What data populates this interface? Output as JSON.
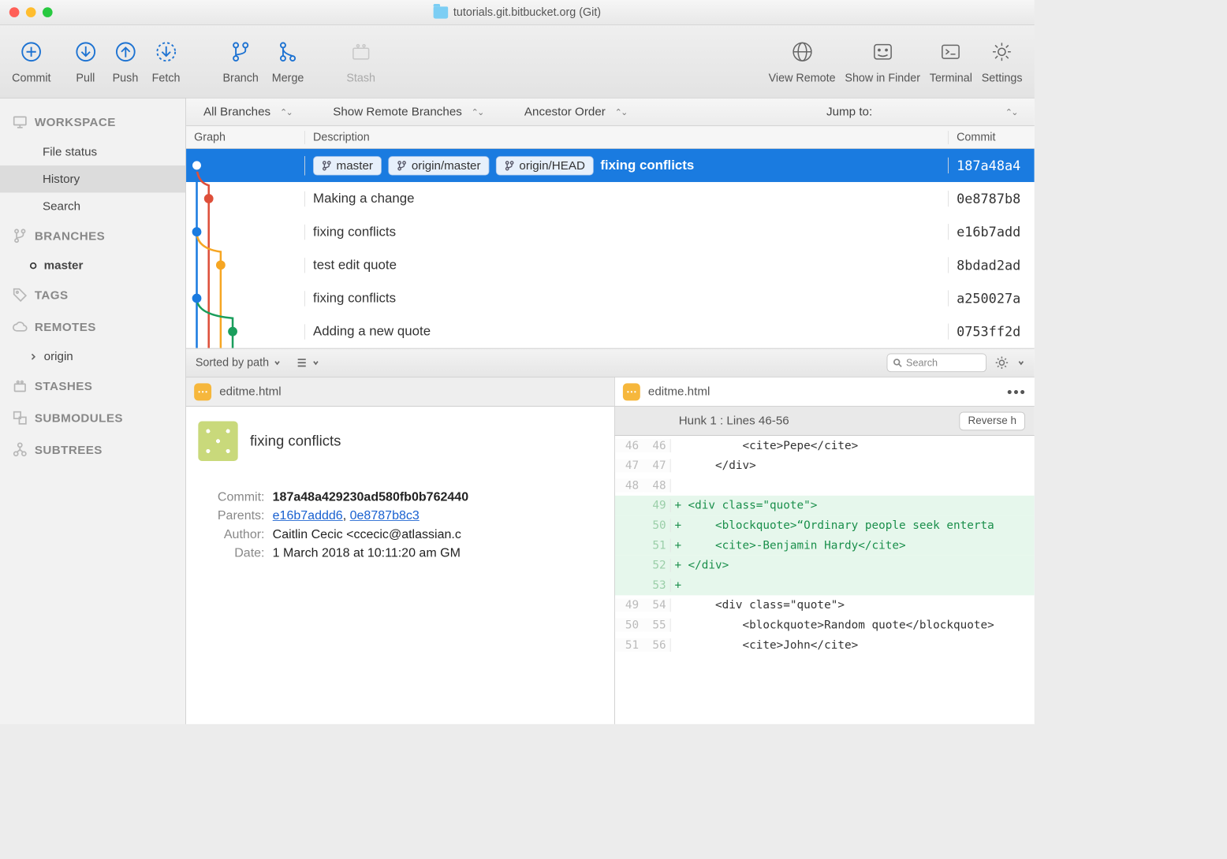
{
  "window": {
    "title": "tutorials.git.bitbucket.org (Git)"
  },
  "toolbar": {
    "commit": "Commit",
    "pull": "Pull",
    "push": "Push",
    "fetch": "Fetch",
    "branch": "Branch",
    "merge": "Merge",
    "stash": "Stash",
    "view_remote": "View Remote",
    "show_finder": "Show in Finder",
    "terminal": "Terminal",
    "settings": "Settings"
  },
  "sidebar": {
    "workspace": {
      "header": "WORKSPACE",
      "file_status": "File status",
      "history": "History",
      "search": "Search"
    },
    "branches": {
      "header": "BRANCHES",
      "master": "master"
    },
    "tags": {
      "header": "TAGS"
    },
    "remotes": {
      "header": "REMOTES",
      "origin": "origin"
    },
    "stashes": {
      "header": "STASHES"
    },
    "submodules": {
      "header": "SUBMODULES"
    },
    "subtrees": {
      "header": "SUBTREES"
    }
  },
  "filter": {
    "branches": "All Branches",
    "remote": "Show Remote Branches",
    "order": "Ancestor Order",
    "jump": "Jump to:"
  },
  "columns": {
    "graph": "Graph",
    "desc": "Description",
    "commit": "Commit"
  },
  "commits": [
    {
      "desc": "fixing conflicts",
      "hash": "187a48a4",
      "tags": [
        "master",
        "origin/master",
        "origin/HEAD"
      ],
      "selected": true
    },
    {
      "desc": "Making a change",
      "hash": "0e8787b8"
    },
    {
      "desc": "fixing conflicts",
      "hash": "e16b7add"
    },
    {
      "desc": "test edit quote",
      "hash": "8bdad2ad"
    },
    {
      "desc": "fixing conflicts",
      "hash": "a250027a"
    },
    {
      "desc": "Adding a new quote",
      "hash": "0753ff2d"
    }
  ],
  "mid": {
    "sort": "Sorted by path",
    "search_ph": "Search"
  },
  "file": {
    "name": "editme.html"
  },
  "detail": {
    "message": "fixing conflicts",
    "commit_label": "Commit:",
    "commit": "187a48a429230ad580fb0b762440",
    "parents_label": "Parents:",
    "parent1": "e16b7addd6",
    "parent2": "0e8787b8c3",
    "author_label": "Author:",
    "author": "Caitlin Cecic <ccecic@atlassian.c",
    "date_label": "Date:",
    "date": "1 March 2018 at 10:11:20 am GM"
  },
  "hunk": {
    "title": "Hunk 1 : Lines 46-56",
    "reverse": "Reverse h"
  },
  "diff": [
    {
      "a": "46",
      "b": "46",
      "s": "",
      "t": "        <cite>Pepe</cite>"
    },
    {
      "a": "47",
      "b": "47",
      "s": "",
      "t": "    </div>"
    },
    {
      "a": "48",
      "b": "48",
      "s": "",
      "t": ""
    },
    {
      "a": "",
      "b": "49",
      "s": "+",
      "t": "<div class=\"quote\">",
      "add": true
    },
    {
      "a": "",
      "b": "50",
      "s": "+",
      "t": "    <blockquote>“Ordinary people seek enterta",
      "add": true
    },
    {
      "a": "",
      "b": "51",
      "s": "+",
      "t": "    <cite>-Benjamin Hardy</cite>",
      "add": true
    },
    {
      "a": "",
      "b": "52",
      "s": "+",
      "t": "</div>",
      "add": true
    },
    {
      "a": "",
      "b": "53",
      "s": "+",
      "t": "",
      "add": true
    },
    {
      "a": "49",
      "b": "54",
      "s": "",
      "t": "    <div class=\"quote\">"
    },
    {
      "a": "50",
      "b": "55",
      "s": "",
      "t": "        <blockquote>Random quote</blockquote>"
    },
    {
      "a": "51",
      "b": "56",
      "s": "",
      "t": "        <cite>John</cite>"
    }
  ]
}
